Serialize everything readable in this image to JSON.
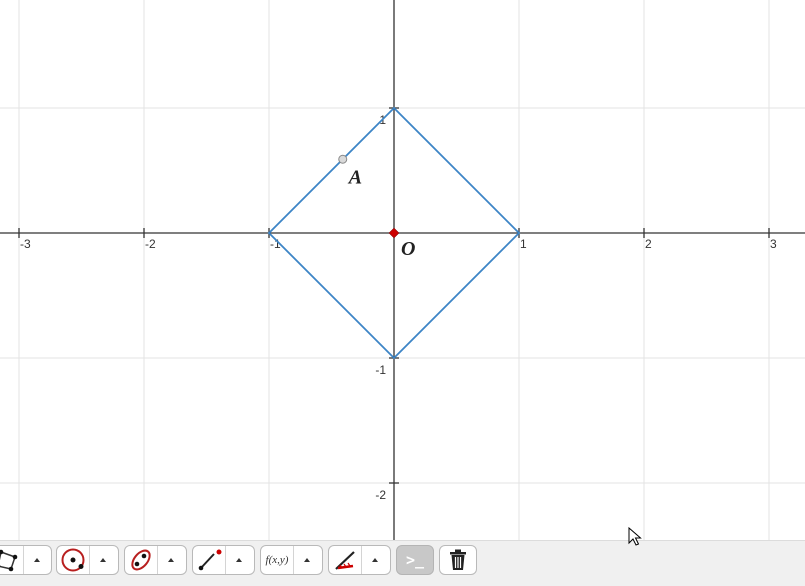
{
  "graph": {
    "x_tick_labels": [
      "-3",
      "-2",
      "-1",
      "1",
      "2",
      "3"
    ],
    "y_tick_labels": [
      "1",
      "-1",
      "-2"
    ],
    "x_ticks": [
      -3,
      -2,
      -1,
      1,
      2,
      3
    ],
    "y_ticks": [
      1,
      -1,
      -2
    ],
    "polygon": [
      [
        0,
        1
      ],
      [
        1,
        0
      ],
      [
        0,
        -1
      ],
      [
        -1,
        0
      ]
    ],
    "polygon_color": "#3d85c6",
    "point_A": {
      "label": "A",
      "x": -0.41,
      "y": 0.59
    },
    "point_O": {
      "label": "O",
      "x": 0,
      "y": 0,
      "color": "#cc0000"
    }
  },
  "toolbar": {
    "tools": [
      {
        "icon": "polygon-tool-icon"
      },
      {
        "icon": "circle-tool-icon"
      },
      {
        "icon": "conic-tool-icon"
      },
      {
        "icon": "segment-point-tool-icon"
      },
      {
        "icon": "function-tool-icon",
        "label": "f(x,y)"
      },
      {
        "icon": "measure-tool-icon"
      }
    ],
    "input_label": ">_",
    "colors": {
      "accent": "#cc0000"
    }
  }
}
